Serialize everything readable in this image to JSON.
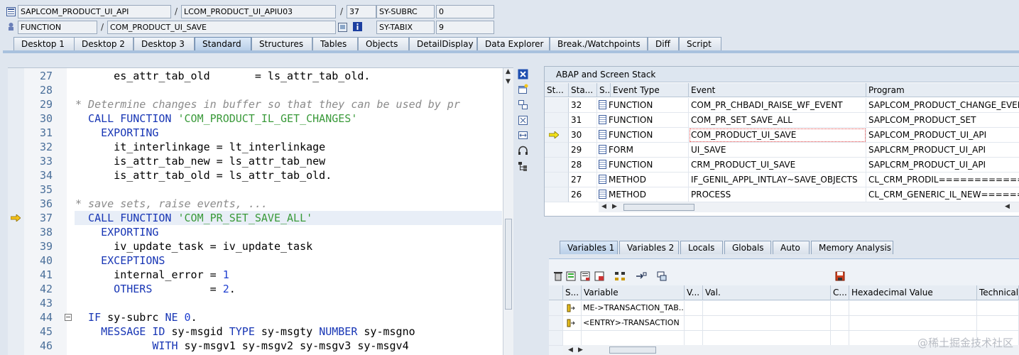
{
  "header": {
    "program": "SAPLCOM_PRODUCT_UI_API",
    "include": "LCOM_PRODUCT_UI_APIU03",
    "line": "37",
    "sysubrc_label": "SY-SUBRC",
    "sysubrc_value": "0",
    "event_type": "FUNCTION",
    "event_name": "COM_PRODUCT_UI_SAVE",
    "sytabix_label": "SY-TABIX",
    "sytabix_value": "9",
    "separator": "/"
  },
  "tabs": [
    {
      "label": "Desktop 1"
    },
    {
      "label": "Desktop 2"
    },
    {
      "label": "Desktop 3"
    },
    {
      "label": "Standard",
      "active": true
    },
    {
      "label": "Structures"
    },
    {
      "label": "Tables"
    },
    {
      "label": "Objects"
    },
    {
      "label": "DetailDisplay"
    },
    {
      "label": "Data Explorer"
    },
    {
      "label": "Break./Watchpoints"
    },
    {
      "label": "Diff"
    },
    {
      "label": "Script"
    }
  ],
  "code": {
    "current_line": "37",
    "lines": [
      {
        "n": "27",
        "parts": [
          {
            "t": "      es_attr_tab_old       = ls_attr_tab_old.",
            "c": ""
          }
        ]
      },
      {
        "n": "28",
        "parts": []
      },
      {
        "n": "29",
        "parts": [
          {
            "t": "* Determine changes in buffer so that they can be used by pr",
            "c": "cm"
          }
        ]
      },
      {
        "n": "30",
        "parts": [
          {
            "t": "  CALL FUNCTION ",
            "c": "kw"
          },
          {
            "t": "'COM_PRODUCT_IL_GET_CHANGES'",
            "c": "st"
          }
        ]
      },
      {
        "n": "31",
        "parts": [
          {
            "t": "    EXPORTING",
            "c": "kw"
          }
        ]
      },
      {
        "n": "32",
        "parts": [
          {
            "t": "      it_interlinkage = lt_interlinkage",
            "c": ""
          }
        ]
      },
      {
        "n": "33",
        "parts": [
          {
            "t": "      is_attr_tab_new = ls_attr_tab_new",
            "c": ""
          }
        ]
      },
      {
        "n": "34",
        "parts": [
          {
            "t": "      is_attr_tab_old = ls_attr_tab_old.",
            "c": ""
          }
        ]
      },
      {
        "n": "35",
        "parts": []
      },
      {
        "n": "36",
        "parts": [
          {
            "t": "* save sets, raise events, ...",
            "c": "cm"
          }
        ]
      },
      {
        "n": "37",
        "parts": [
          {
            "t": "  CALL FUNCTION ",
            "c": "kw"
          },
          {
            "t": "'COM_PR_SET_SAVE_ALL'",
            "c": "st"
          }
        ]
      },
      {
        "n": "38",
        "parts": [
          {
            "t": "    EXPORTING",
            "c": "kw"
          }
        ]
      },
      {
        "n": "39",
        "parts": [
          {
            "t": "      iv_update_task = iv_update_task",
            "c": ""
          }
        ]
      },
      {
        "n": "40",
        "parts": [
          {
            "t": "    EXCEPTIONS",
            "c": "kw"
          }
        ]
      },
      {
        "n": "41",
        "parts": [
          {
            "t": "      internal_error = ",
            "c": ""
          },
          {
            "t": "1",
            "c": "nm"
          }
        ]
      },
      {
        "n": "42",
        "parts": [
          {
            "t": "      OTHERS",
            "c": "kw"
          },
          {
            "t": "         = ",
            "c": ""
          },
          {
            "t": "2",
            "c": "nm"
          },
          {
            "t": ".",
            "c": ""
          }
        ]
      },
      {
        "n": "43",
        "parts": []
      },
      {
        "n": "44",
        "parts": [
          {
            "t": "  IF ",
            "c": "kw"
          },
          {
            "t": "sy-subrc ",
            "c": ""
          },
          {
            "t": "NE ",
            "c": "kw"
          },
          {
            "t": "0",
            "c": "nm"
          },
          {
            "t": ".",
            "c": ""
          }
        ]
      },
      {
        "n": "45",
        "parts": [
          {
            "t": "    MESSAGE ID ",
            "c": "kw"
          },
          {
            "t": "sy-msgid ",
            "c": ""
          },
          {
            "t": "TYPE ",
            "c": "kw"
          },
          {
            "t": "sy-msgty ",
            "c": ""
          },
          {
            "t": "NUMBER ",
            "c": "kw"
          },
          {
            "t": "sy-msgno",
            "c": ""
          }
        ]
      },
      {
        "n": "46",
        "parts": [
          {
            "t": "            WITH ",
            "c": "kw"
          },
          {
            "t": "sy-msgv1 sy-msgv2 sy-msgv3 sy-msgv4",
            "c": ""
          }
        ]
      }
    ]
  },
  "stack": {
    "title": "ABAP and Screen Stack",
    "columns": [
      "St...",
      "Sta...",
      "S...",
      "Event Type",
      "Event",
      "Program"
    ],
    "rows": [
      {
        "level": "32",
        "type": "FUNCTION",
        "event": "COM_PR_CHBADI_RAISE_WF_EVENT",
        "program": "SAPLCOM_PRODUCT_CHANGE_EVENT"
      },
      {
        "level": "31",
        "type": "FUNCTION",
        "event": "COM_PR_SET_SAVE_ALL",
        "program": "SAPLCOM_PRODUCT_SET"
      },
      {
        "level": "30",
        "type": "FUNCTION",
        "event": "COM_PRODUCT_UI_SAVE",
        "program": "SAPLCOM_PRODUCT_UI_API",
        "current": true
      },
      {
        "level": "29",
        "type": "FORM",
        "event": "UI_SAVE",
        "program": "SAPLCRM_PRODUCT_UI_API"
      },
      {
        "level": "28",
        "type": "FUNCTION",
        "event": "CRM_PRODUCT_UI_SAVE",
        "program": "SAPLCRM_PRODUCT_UI_API"
      },
      {
        "level": "27",
        "type": "METHOD",
        "event": "IF_GENIL_APPL_INTLAY~SAVE_OBJECTS",
        "program": "CL_CRM_PRODIL=============="
      },
      {
        "level": "26",
        "type": "METHOD",
        "event": "PROCESS",
        "program": "CL_CRM_GENERIC_IL_NEW======="
      }
    ]
  },
  "var_tabs": [
    {
      "label": "Variables 1",
      "active": true
    },
    {
      "label": "Variables 2"
    },
    {
      "label": "Locals"
    },
    {
      "label": "Globals"
    },
    {
      "label": "Auto"
    },
    {
      "label": "Memory Analysis"
    }
  ],
  "variables": {
    "columns": [
      "S...",
      "Variable",
      "V...",
      "Val.",
      "C...",
      "Hexadecimal Value",
      "Technical"
    ],
    "rows": [
      {
        "name": "ME->TRANSACTION_TAB..."
      },
      {
        "name": "<ENTRY>-TRANSACTION"
      }
    ]
  },
  "watermark": "@稀土掘金技术社区",
  "colors": {
    "accent": "#a8c1de",
    "current_line": "#e8eef7",
    "keyword": "#1836b5",
    "string": "#3a9a3a",
    "comment": "#8a8a8a"
  }
}
